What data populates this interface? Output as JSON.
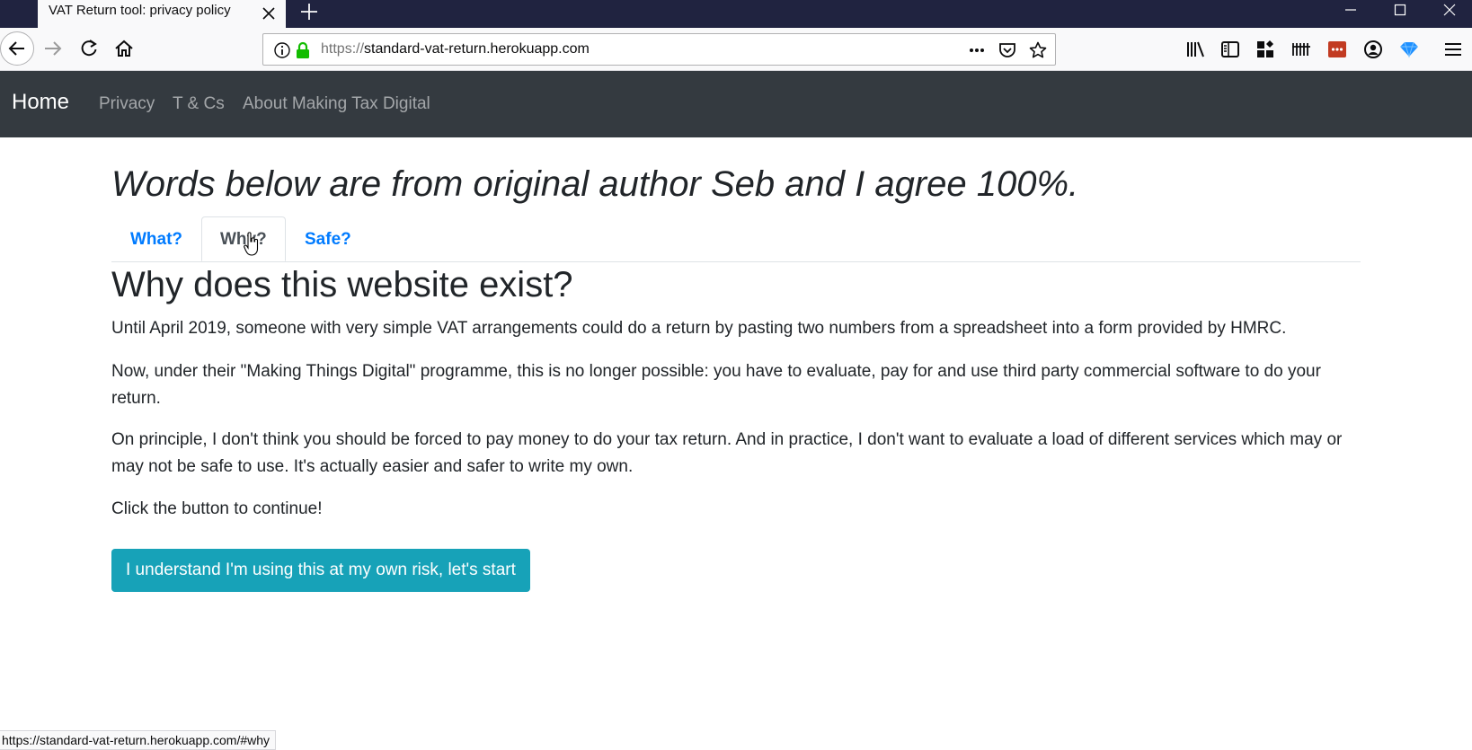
{
  "browser": {
    "tab_title": "VAT Return tool: privacy policy",
    "url_scheme": "https://",
    "url_host": "standard-vat-return.herokuapp.com",
    "status_url": "https://standard-vat-return.herokuapp.com/#why"
  },
  "navbar": {
    "brand": "Home",
    "links": [
      "Privacy",
      "T & Cs",
      "About Making Tax Digital"
    ]
  },
  "main": {
    "lead": "Words below are from original author Seb and I agree 100%.",
    "tabs": [
      {
        "label": "What?",
        "active": false
      },
      {
        "label": "Why?",
        "active": true
      },
      {
        "label": "Safe?",
        "active": false
      }
    ],
    "heading": "Why does this website exist?",
    "paragraphs": [
      "Until April 2019, someone with very simple VAT arrangements could do a return by pasting two numbers from a spreadsheet into a form provided by HMRC.",
      "Now, under their \"Making Things Digital\" programme, this is no longer possible: you have to evaluate, pay for and use third party commercial software to do your return.",
      "On principle, I don't think you should be forced to pay money to do your tax return. And in practice, I don't want to evaluate a load of different services which may or may not be safe to use. It's actually easier and safer to write my own.",
      "Click the button to continue!"
    ],
    "button_label": "I understand I'm using this at my own risk, let's start"
  },
  "colors": {
    "navbar_bg": "#343a40",
    "tab_link": "#007bff",
    "button_bg": "#17a2b8",
    "tabstrip_bg": "#202340"
  }
}
